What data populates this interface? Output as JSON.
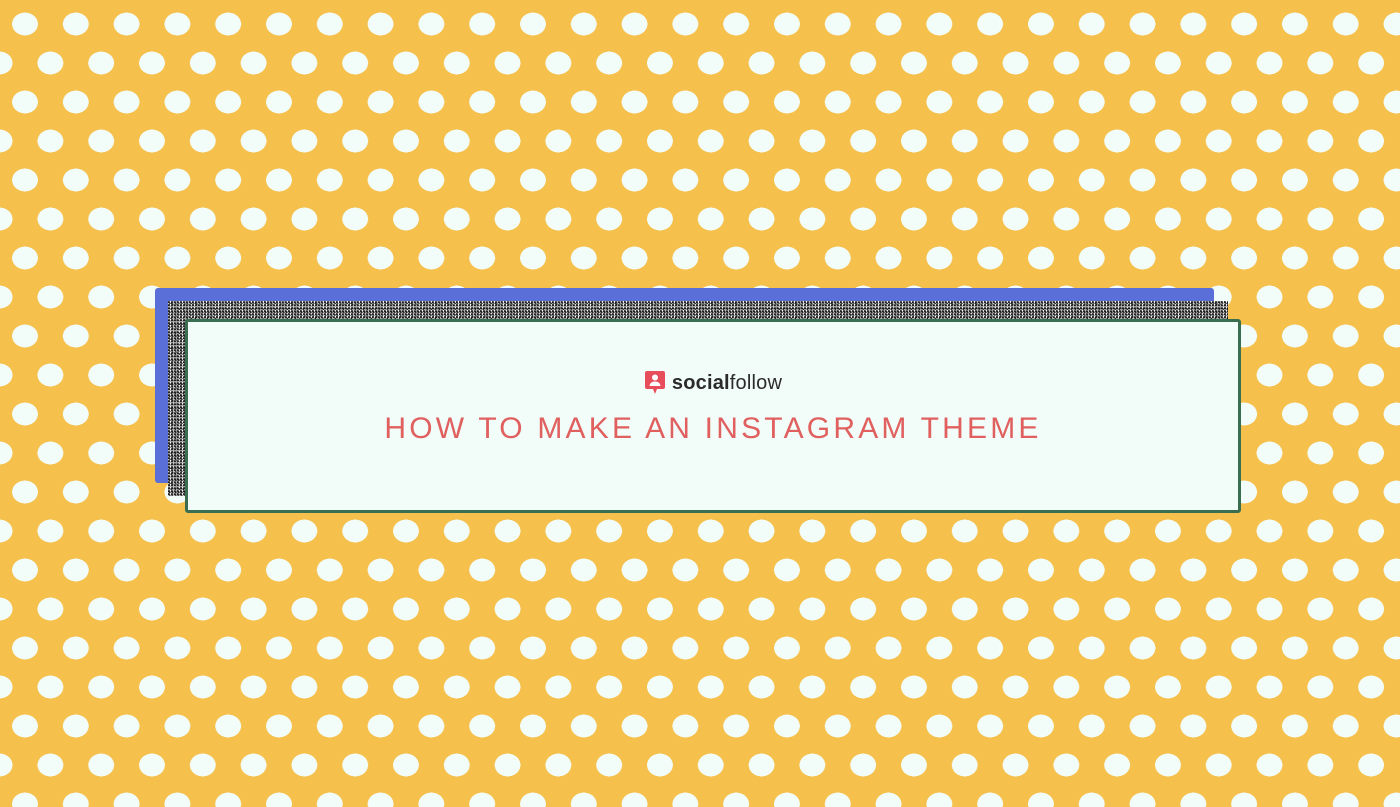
{
  "brand": {
    "name_bold": "social",
    "name_light": "follow",
    "icon": "chat-bubble-person-icon",
    "color": "#e84d5b"
  },
  "headline": "HOW TO MAKE AN INSTAGRAM THEME",
  "colors": {
    "background": "#f5c04c",
    "dots": "#f2fcf8",
    "headline": "#e0605f",
    "card_border": "#3b6e50",
    "blue_layer": "#5b6fd8",
    "card_fill": "#f2fcf8"
  }
}
